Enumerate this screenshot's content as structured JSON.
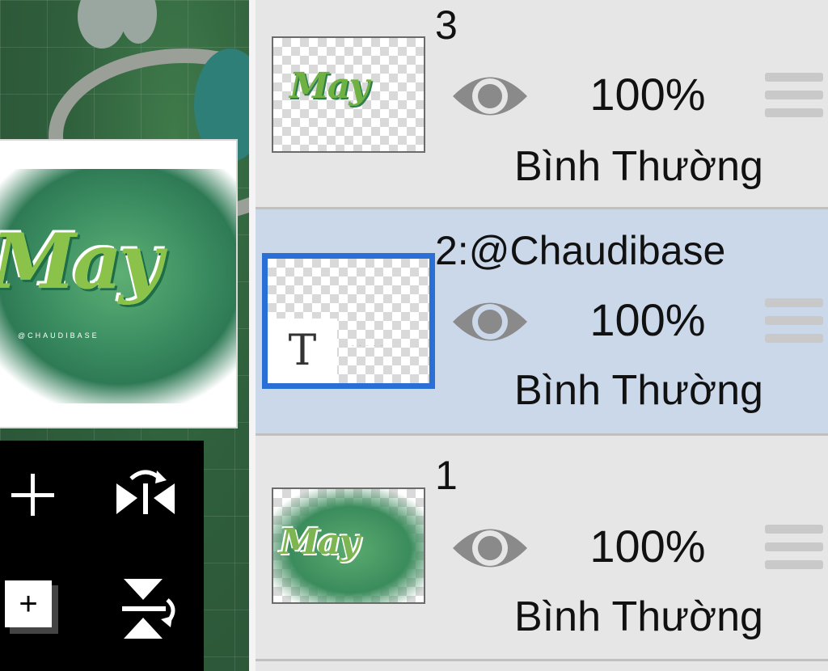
{
  "canvas": {
    "preview_word": "May",
    "preview_small_text": "@CHAUDIBASE"
  },
  "tools": {
    "add_icon": "plus-icon",
    "add_layer_icon": "add-layer-icon",
    "add_layer_symbol": "+",
    "flip_horizontal_icon": "flip-horizontal-icon",
    "flip_vertical_icon": "flip-vertical-icon"
  },
  "layers": [
    {
      "name": "3",
      "opacity": "100%",
      "blend": "Bình Thường",
      "thumb_word": "May",
      "selected": false
    },
    {
      "name": "2:@Chaudibase",
      "opacity": "100%",
      "blend": "Bình Thường",
      "thumb_letter": "T",
      "selected": true
    },
    {
      "name": "1",
      "opacity": "100%",
      "blend": "Bình Thường",
      "thumb_word": "May",
      "selected": false
    }
  ],
  "colors": {
    "selected_row": "#cbd8ea",
    "selected_border": "#2a6fd6",
    "panel_bg": "#e6e6e6"
  }
}
